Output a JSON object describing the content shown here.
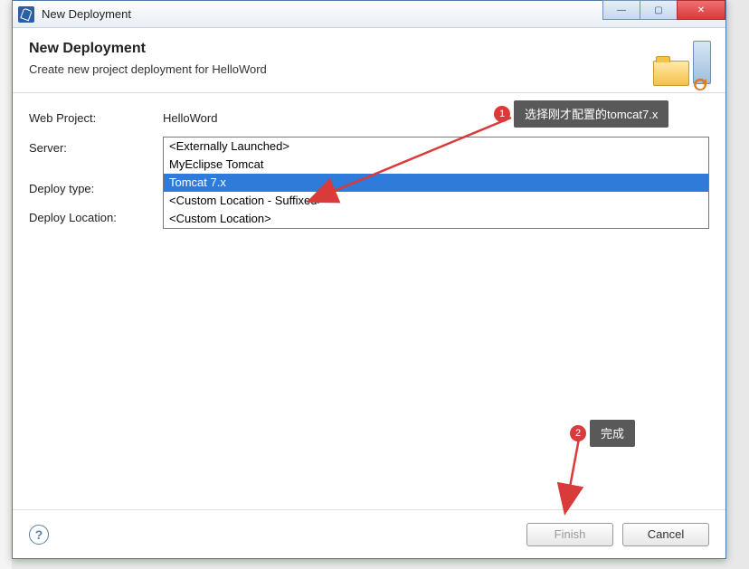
{
  "titlebar": {
    "title": "New Deployment",
    "minimize": "—",
    "maximize": "▢",
    "close": "✕"
  },
  "header": {
    "heading": "New Deployment",
    "subtitle": "Create new project deployment for HelloWord"
  },
  "form": {
    "web_project_label": "Web Project:",
    "web_project_value": "HelloWord",
    "server_label": "Server:",
    "deploy_type_label": "Deploy type:",
    "deploy_location_label": "Deploy Location:"
  },
  "dropdown": {
    "options": [
      "<Externally Launched>",
      "MyEclipse Tomcat",
      "Tomcat  7.x",
      "<Custom Location - Suffixed>",
      "<Custom Location>"
    ],
    "selected_index": 2
  },
  "buttons": {
    "help": "?",
    "finish": "Finish",
    "cancel": "Cancel"
  },
  "annotations": {
    "callout1_num": "1",
    "callout1_text": "选择刚才配置的tomcat7.x",
    "callout2_num": "2",
    "callout2_text": "完成"
  }
}
